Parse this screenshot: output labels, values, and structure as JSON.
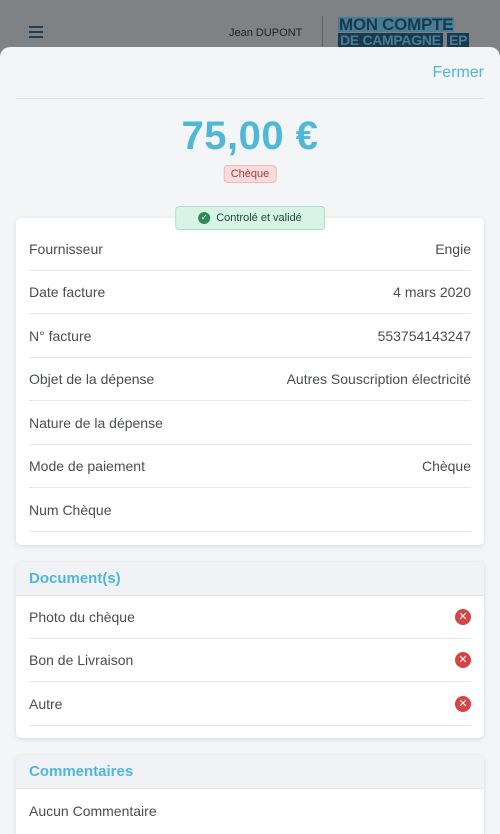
{
  "header": {
    "user_name": "Jean DUPONT",
    "logo_line1": "MON COMPTE",
    "logo_line2": "DE CAMPAGNE",
    "logo_suffix": "EP"
  },
  "modal": {
    "close_label": "Fermer",
    "amount": "75,00 €",
    "payment_badge": "Chèque",
    "status_label": "Controlé et validé",
    "status_color": "#2e8b57"
  },
  "details": [
    {
      "label": "Fournisseur",
      "value": "Engie"
    },
    {
      "label": "Date facture",
      "value": "4 mars 2020"
    },
    {
      "label": "N° facture",
      "value": "553754143247"
    },
    {
      "label": "Objet de la dépense",
      "value": "Autres Souscription électricité"
    },
    {
      "label": "Nature de la dépense",
      "value": ""
    },
    {
      "label": "Mode de paiement",
      "value": "Chèque"
    },
    {
      "label": "Num Chèque",
      "value": ""
    }
  ],
  "documents": {
    "title": "Document(s)",
    "items": [
      {
        "label": "Photo du chèque",
        "icon": "error-icon"
      },
      {
        "label": "Bon de Livraison",
        "icon": "error-icon"
      },
      {
        "label": "Autre",
        "icon": "error-icon"
      }
    ]
  },
  "comments": {
    "title": "Commentaires",
    "empty_text": "Aucun Commentaire"
  },
  "colors": {
    "accent": "#4fb8d6",
    "error": "#d64545",
    "success_bg": "#d8f4e6"
  }
}
